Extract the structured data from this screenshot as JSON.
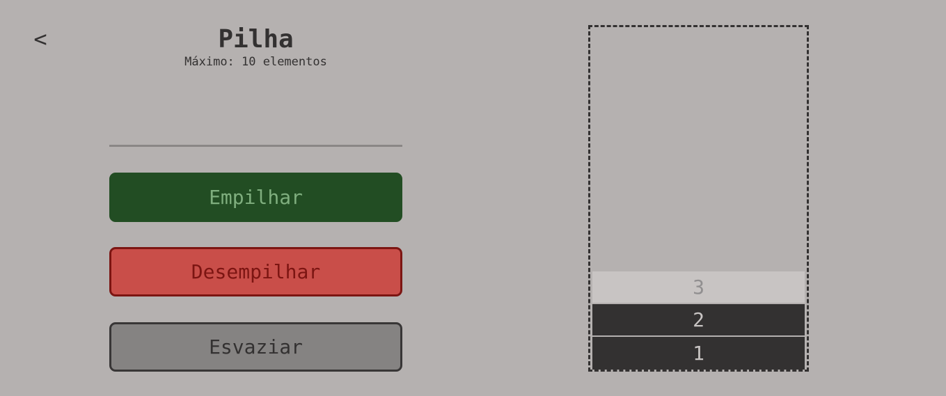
{
  "nav": {
    "back_label": "<"
  },
  "header": {
    "title": "Pilha",
    "subtitle": "Máximo: 10 elementos"
  },
  "input": {
    "value": "",
    "placeholder": ""
  },
  "buttons": {
    "push_label": "Empilhar",
    "pop_label": "Desempilhar",
    "clear_label": "Esvaziar"
  },
  "stack": {
    "items": [
      "3",
      "2",
      "1"
    ]
  },
  "colors": {
    "background": "#b5b1b0",
    "push": "#224d23",
    "pop": "#c94e49",
    "clear": "#858382",
    "stack_item": "#333131",
    "stack_top": "#c8c4c3"
  }
}
